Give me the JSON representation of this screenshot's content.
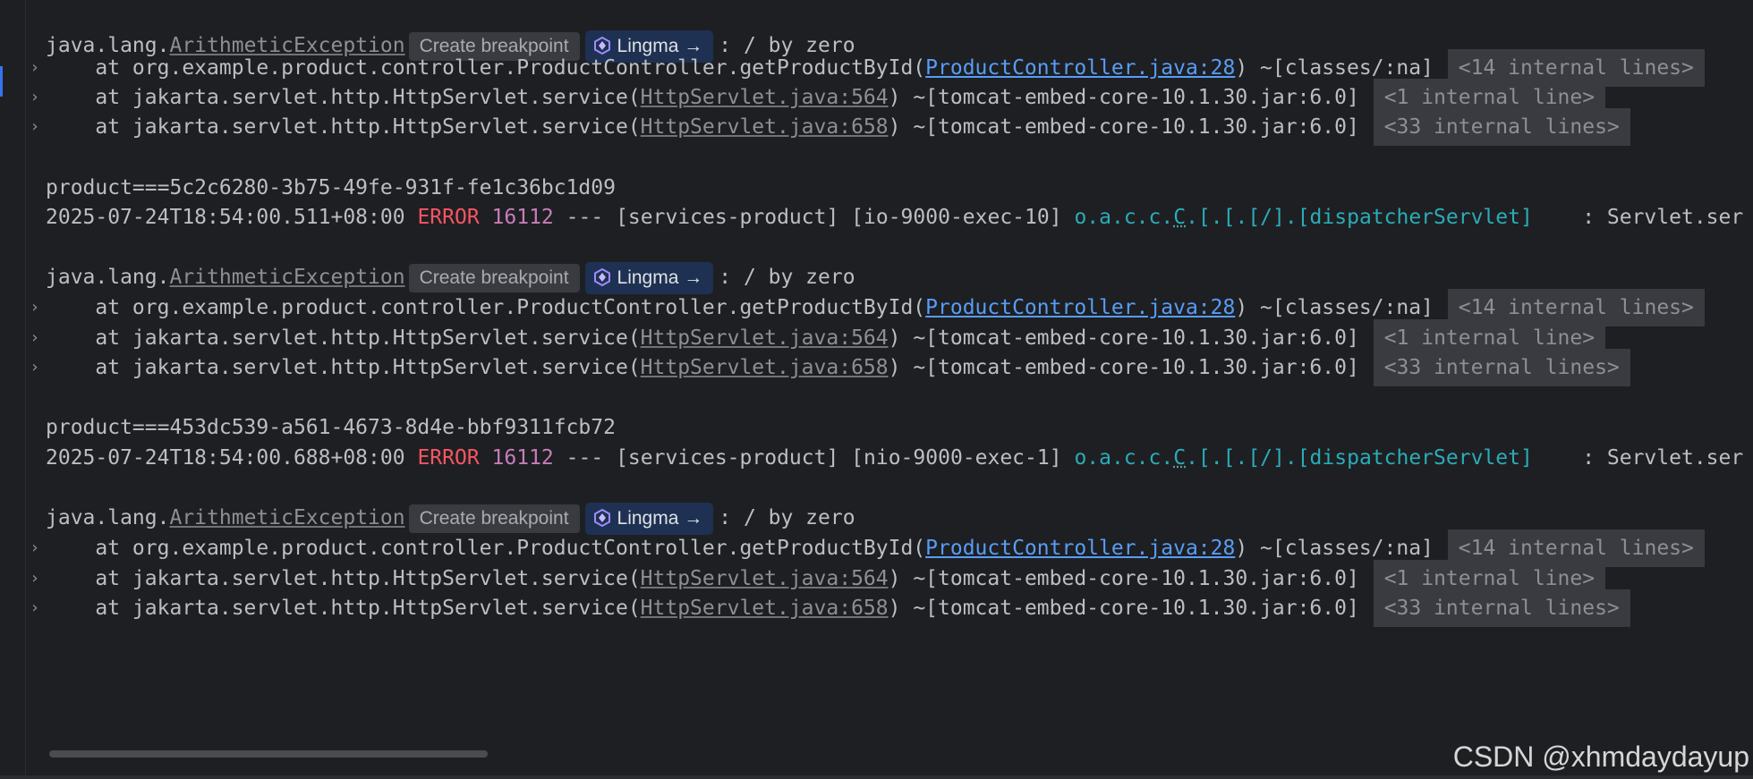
{
  "lingma_label": "Lingma →",
  "create_breakpoint_label": "Create breakpoint",
  "watermark": "CSDN @xhmdaydayup",
  "colors": {
    "background": "#1e1f22",
    "error": "#f75464",
    "pid": "#c77dbb",
    "logger": "#2aacb8",
    "link": "#589df6",
    "lingma_chip": "#1e3152"
  },
  "blocks": [
    {
      "exception": {
        "prefix": "java.lang.",
        "class_link": "ArithmeticException",
        "message": ": / by zero"
      },
      "frames": [
        {
          "text": "    at org.example.product.controller.ProductController.getProductById(",
          "link": "ProductController.java:28",
          "suffix": ") ~[classes/:na]",
          "internal": "<14 internal lines>"
        },
        {
          "text": "    at jakarta.servlet.http.HttpServlet.service(",
          "link": "HttpServlet.java:564",
          "suffix": ") ~[tomcat-embed-core-10.1.30.jar:6.0]",
          "internal": "<1 internal line>"
        },
        {
          "text": "    at jakarta.servlet.http.HttpServlet.service(",
          "link": "HttpServlet.java:658",
          "suffix": ") ~[tomcat-embed-core-10.1.30.jar:6.0]",
          "internal": "<33 internal lines>"
        }
      ],
      "product_line": "product===5c2c6280-3b75-49fe-931f-fe1c36bc1d09",
      "log_line": {
        "timestamp": "2025-07-24T18:54:00.511+08:00",
        "level": "ERROR",
        "pid": "16112",
        "dashes": "---",
        "app": "[services-product]",
        "thread": "[io-9000-exec-10]",
        "logger_a": "o.a.c.c.",
        "logger_b": "C",
        "logger_c": ".[.[.[/].[dispatcherServlet]",
        "message": "    : Servlet.ser"
      }
    },
    {
      "exception": {
        "prefix": "java.lang.",
        "class_link": "ArithmeticException",
        "message": ": / by zero"
      },
      "frames": [
        {
          "text": "    at org.example.product.controller.ProductController.getProductById(",
          "link": "ProductController.java:28",
          "suffix": ") ~[classes/:na]",
          "internal": "<14 internal lines>"
        },
        {
          "text": "    at jakarta.servlet.http.HttpServlet.service(",
          "link": "HttpServlet.java:564",
          "suffix": ") ~[tomcat-embed-core-10.1.30.jar:6.0]",
          "internal": "<1 internal line>"
        },
        {
          "text": "    at jakarta.servlet.http.HttpServlet.service(",
          "link": "HttpServlet.java:658",
          "suffix": ") ~[tomcat-embed-core-10.1.30.jar:6.0]",
          "internal": "<33 internal lines>"
        }
      ],
      "product_line": "product===453dc539-a561-4673-8d4e-bbf9311fcb72",
      "log_line": {
        "timestamp": "2025-07-24T18:54:00.688+08:00",
        "level": "ERROR",
        "pid": "16112",
        "dashes": "---",
        "app": "[services-product]",
        "thread": "[nio-9000-exec-1]",
        "logger_a": "o.a.c.c.",
        "logger_b": "C",
        "logger_c": ".[.[.[/].[dispatcherServlet]",
        "message": "    : Servlet.ser"
      }
    },
    {
      "exception": {
        "prefix": "java.lang.",
        "class_link": "ArithmeticException",
        "message": ": / by zero"
      },
      "frames": [
        {
          "text": "    at org.example.product.controller.ProductController.getProductById(",
          "link": "ProductController.java:28",
          "suffix": ") ~[classes/:na]",
          "internal": "<14 internal lines>"
        },
        {
          "text": "    at jakarta.servlet.http.HttpServlet.service(",
          "link": "HttpServlet.java:564",
          "suffix": ") ~[tomcat-embed-core-10.1.30.jar:6.0]",
          "internal": "<1 internal line>"
        },
        {
          "text": "    at jakarta.servlet.http.HttpServlet.service(",
          "link": "HttpServlet.java:658",
          "suffix": ") ~[tomcat-embed-core-10.1.30.jar:6.0]",
          "internal": "<33 internal lines>"
        }
      ]
    }
  ]
}
